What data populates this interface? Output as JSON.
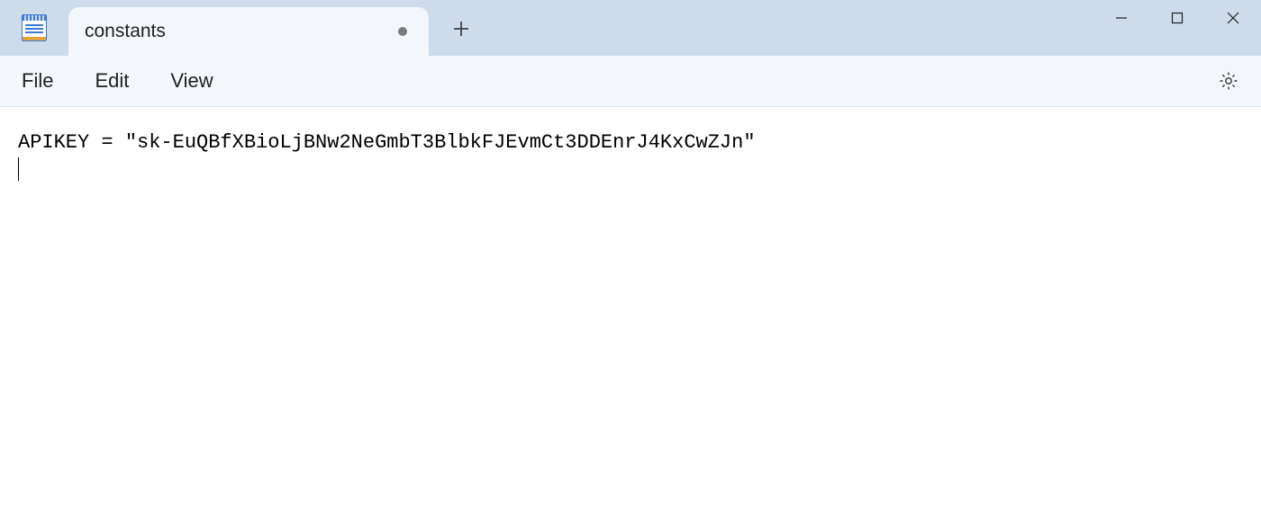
{
  "tabs": [
    {
      "title": "constants",
      "modified": true
    }
  ],
  "window_controls": {
    "minimize_label": "Minimize",
    "maximize_label": "Maximize",
    "close_label": "Close"
  },
  "menubar": {
    "file_label": "File",
    "edit_label": "Edit",
    "view_label": "View"
  },
  "editor": {
    "content": "APIKEY = \"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\""
  }
}
